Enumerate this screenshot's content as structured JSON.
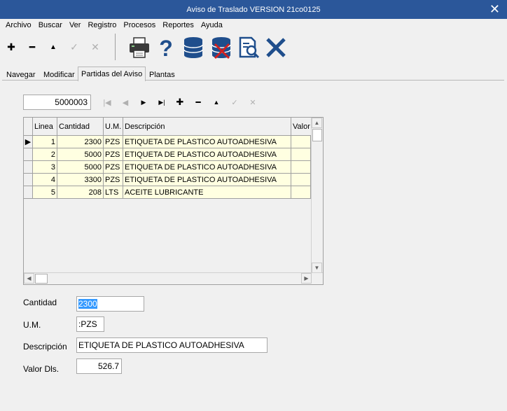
{
  "window": {
    "title": "Aviso de Traslado  VERSION 21co0125",
    "close_icon": "close-icon"
  },
  "menu": [
    "Archivo",
    "Buscar",
    "Ver",
    "Registro",
    "Procesos",
    "Reportes",
    "Ayuda"
  ],
  "tabs": [
    "Navegar",
    "Modificar",
    "Partidas del Aviso",
    "Plantas"
  ],
  "active_tab": "Partidas del Aviso",
  "record_number": "5000003",
  "grid": {
    "columns": [
      "Linea",
      "Cantidad",
      "U.M.",
      "Descripción",
      "Valor"
    ],
    "rows": [
      {
        "linea": "1",
        "cantidad": "2300",
        "um": "PZS",
        "descripcion": "ETIQUETA DE PLASTICO AUTOADHESIVA"
      },
      {
        "linea": "2",
        "cantidad": "5000",
        "um": "PZS",
        "descripcion": "ETIQUETA DE PLASTICO AUTOADHESIVA"
      },
      {
        "linea": "3",
        "cantidad": "5000",
        "um": "PZS",
        "descripcion": "ETIQUETA DE PLASTICO AUTOADHESIVA"
      },
      {
        "linea": "4",
        "cantidad": "3300",
        "um": "PZS",
        "descripcion": "ETIQUETA DE PLASTICO AUTOADHESIVA"
      },
      {
        "linea": "5",
        "cantidad": "208",
        "um": "LTS",
        "descripcion": "ACEITE LUBRICANTE"
      }
    ]
  },
  "form": {
    "cantidad_label": "Cantidad",
    "cantidad_value": "2300",
    "um_label": "U.M.",
    "um_value": ":PZS",
    "descripcion_label": "Descripción",
    "descripcion_value": "ETIQUETA DE PLASTICO AUTOADHESIVA",
    "valor_label": "Valor Dls.",
    "valor_value": "526.7"
  },
  "colors": {
    "titlebar": "#2b579a",
    "row_bg": "#ffffe1",
    "toolbar_icon": "#1f4e8c",
    "delete_red": "#d02020"
  }
}
